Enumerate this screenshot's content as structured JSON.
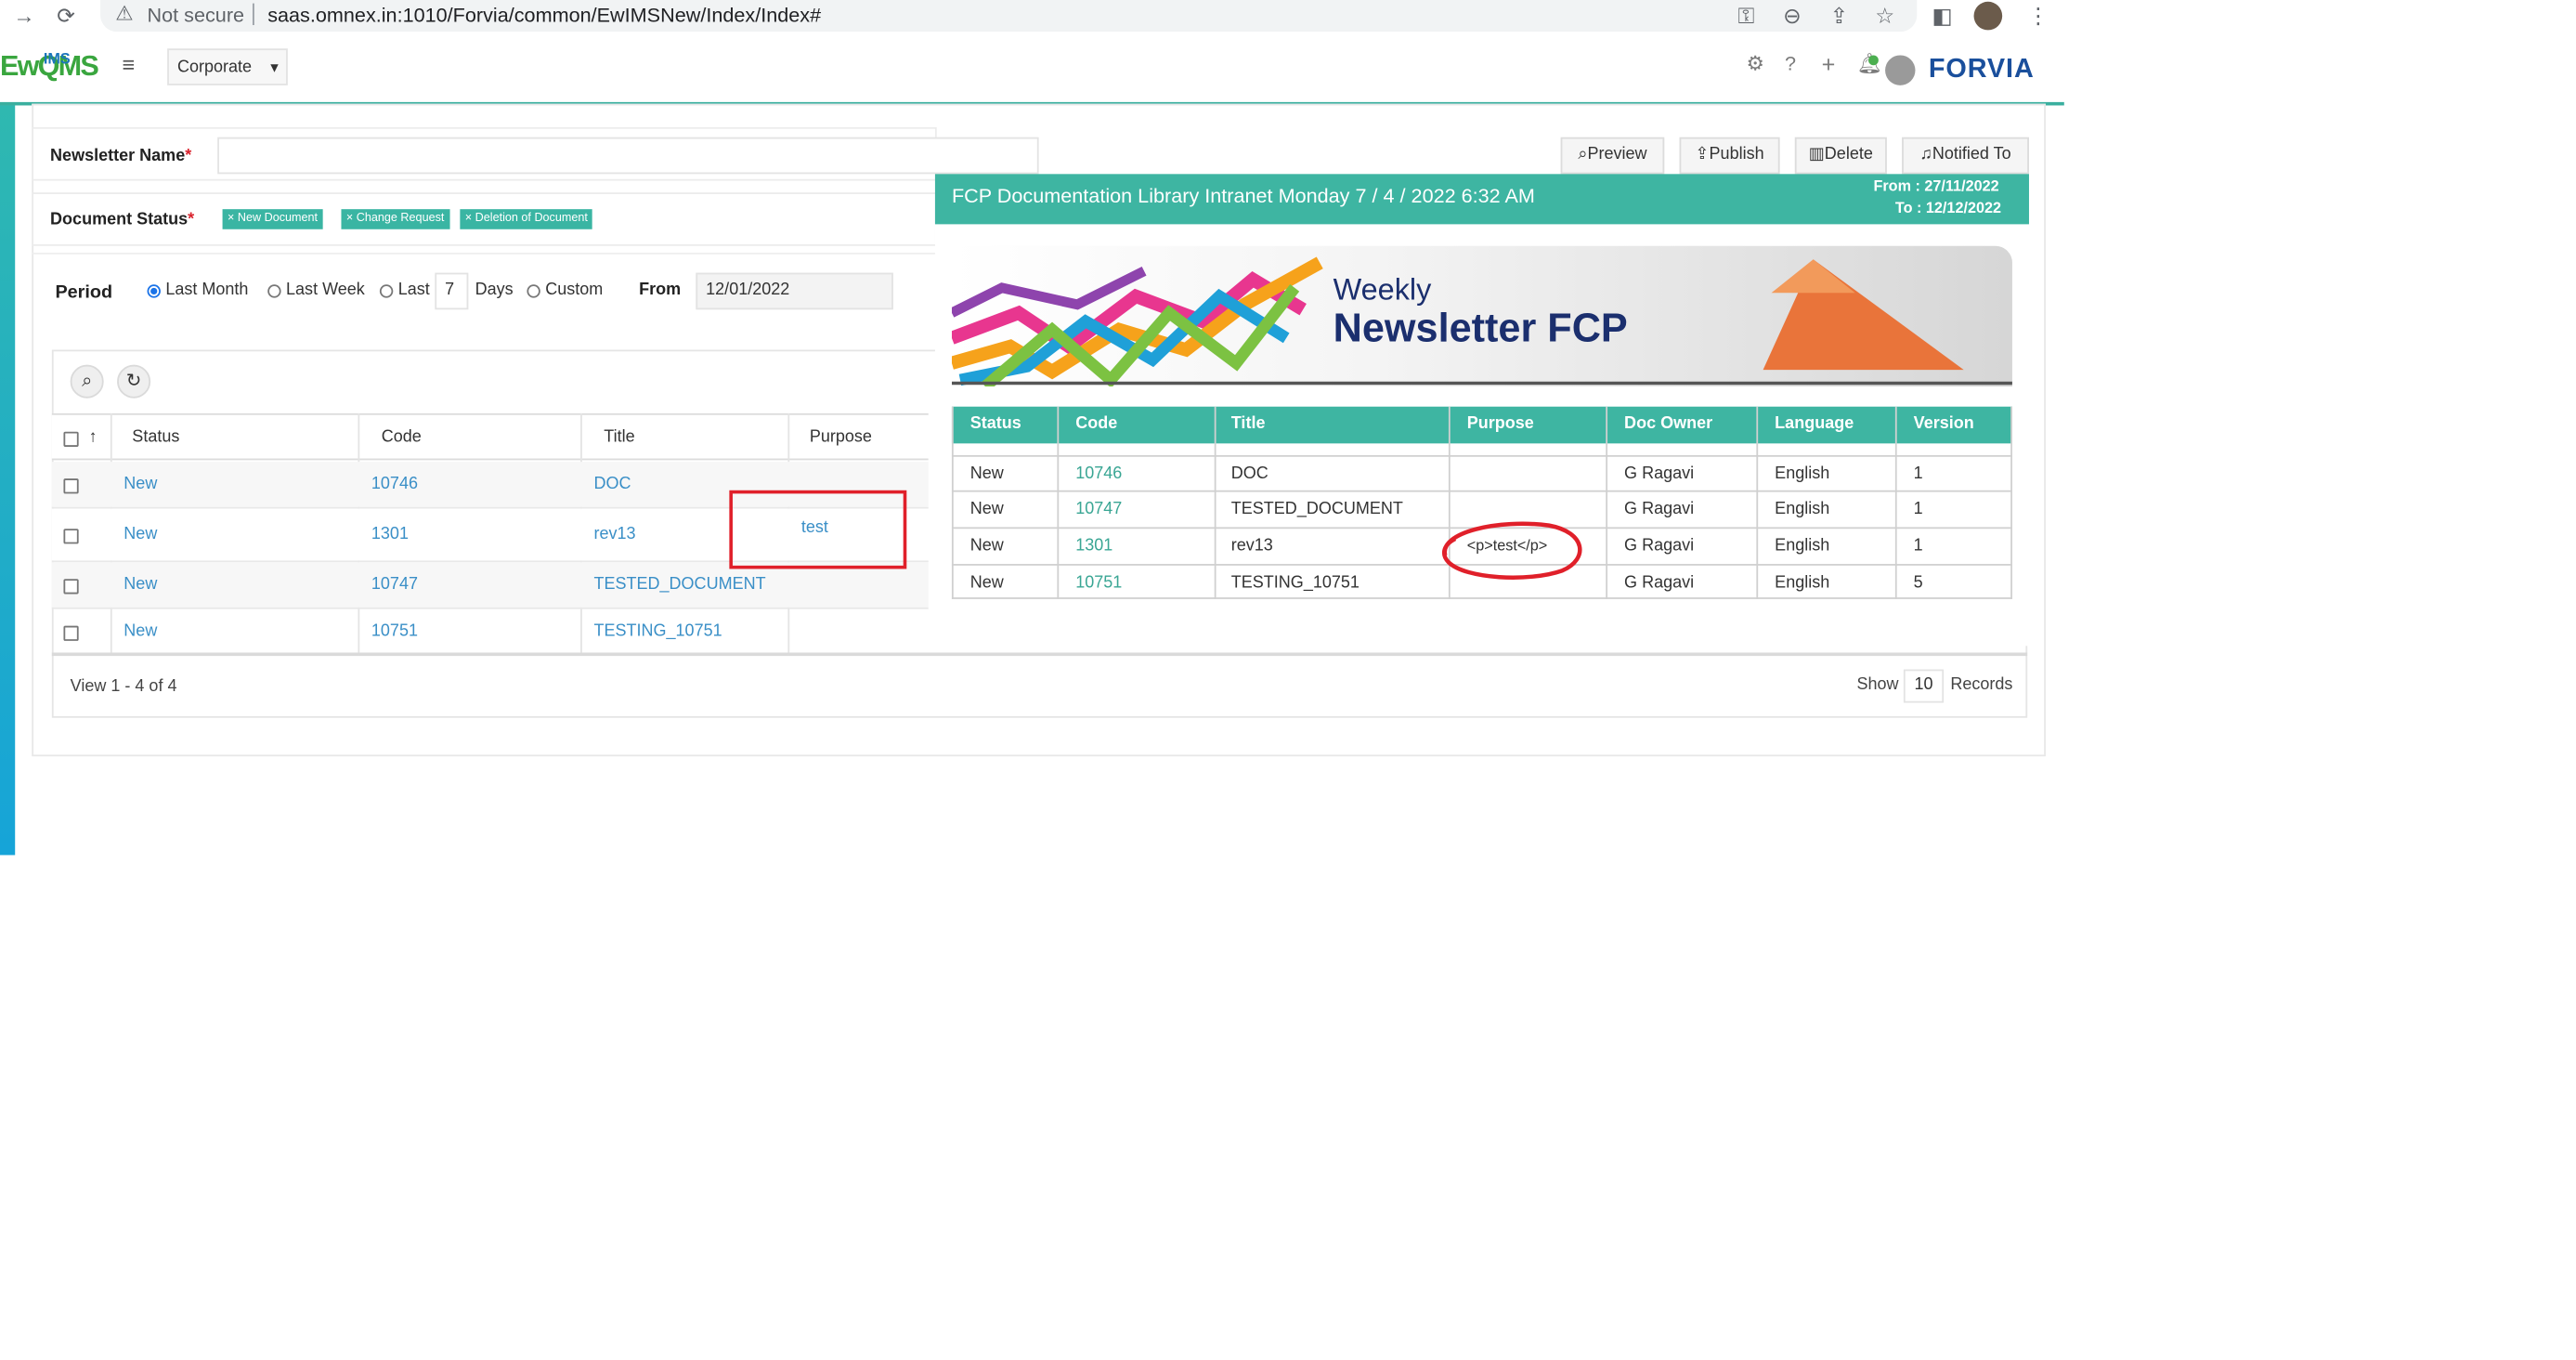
{
  "browser": {
    "security_label": "Not secure",
    "url": "saas.omnex.in:1010/Forvia/common/EwIMSNew/Index/Index#"
  },
  "header": {
    "logo_text": "EwQMS",
    "logo_sub": "IMS",
    "site_select": "Corporate",
    "brand": "FORVIA"
  },
  "form": {
    "newsletter_name_label": "Newsletter Name",
    "newsletter_name_value": "",
    "document_status_label": "Document Status",
    "required_mark": "*",
    "status_tags": [
      "New Document",
      "Change Request",
      "Deletion of Document"
    ],
    "tag_remove": "×",
    "period_label": "Period",
    "period_options": [
      "Last Month",
      "Last Week",
      "Last",
      "Custom"
    ],
    "period_selected": "Last Month",
    "last_days_value": "7",
    "days_label": "Days",
    "from_label": "From",
    "from_value": "12/01/2022"
  },
  "actions": {
    "preview": "Preview",
    "publish": "Publish",
    "delete": "Delete",
    "notified_to": "Notified To"
  },
  "grid": {
    "sort_icon": "↑",
    "columns": [
      "Status",
      "Code",
      "Title",
      "Purpose"
    ],
    "rows": [
      {
        "status": "New",
        "code": "10746",
        "title": "DOC",
        "purpose": ""
      },
      {
        "status": "New",
        "code": "1301",
        "title": "rev13",
        "purpose": "test"
      },
      {
        "status": "New",
        "code": "10747",
        "title": "TESTED_DOCUMENT",
        "purpose": ""
      },
      {
        "status": "New",
        "code": "10751",
        "title": "TESTING_10751",
        "purpose": ""
      }
    ],
    "view_text": "View 1 - 4 of 4",
    "show_label": "Show",
    "show_value": "10",
    "records_label": "Records"
  },
  "preview": {
    "title": "FCP Documentation Library Intranet Monday 7 / 4 / 2022 6:32 AM",
    "from_label": "From : ",
    "from_date": "27/11/2022",
    "to_label": "To : ",
    "to_date": "12/12/2022",
    "banner_line1": "Weekly",
    "banner_line2": "Newsletter FCP",
    "columns": [
      "Status",
      "Code",
      "Title",
      "Purpose",
      "Doc Owner",
      "Language",
      "Version"
    ],
    "rows": [
      {
        "status": "New",
        "code": "10746",
        "title": "DOC",
        "purpose": "",
        "owner": "G Ragavi",
        "language": "English",
        "version": "1"
      },
      {
        "status": "New",
        "code": "10747",
        "title": "TESTED_DOCUMENT",
        "purpose": "",
        "owner": "G Ragavi",
        "language": "English",
        "version": "1"
      },
      {
        "status": "New",
        "code": "1301",
        "title": "rev13",
        "purpose": "<p>test</p>",
        "owner": "G Ragavi",
        "language": "English",
        "version": "1"
      },
      {
        "status": "New",
        "code": "10751",
        "title": "TESTING_10751",
        "purpose": "",
        "owner": "G Ragavi",
        "language": "English",
        "version": "5"
      }
    ]
  },
  "colors": {
    "accent": "#3eb5a2",
    "link": "#3a8fc7",
    "annotation": "#e0202a",
    "brand": "#1a4f9c"
  }
}
